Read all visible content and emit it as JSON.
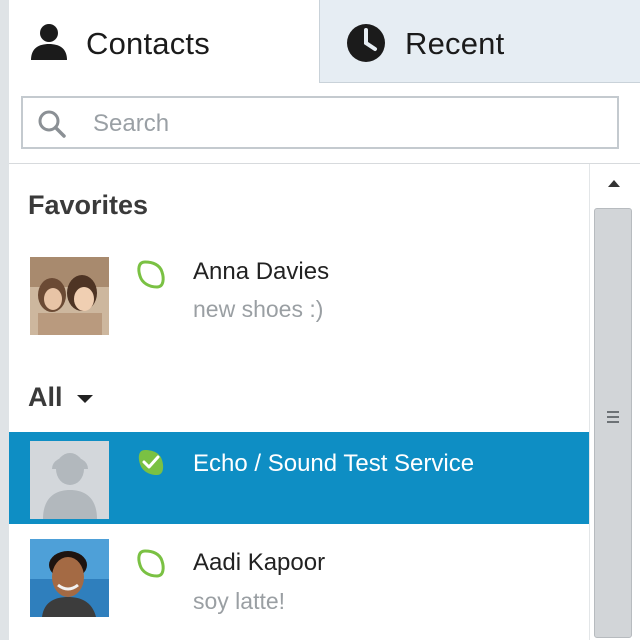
{
  "tabs": {
    "contacts_label": "Contacts",
    "recent_label": "Recent",
    "contacts_icon": "person-icon",
    "recent_icon": "clock-icon"
  },
  "search": {
    "placeholder": "Search",
    "value": "",
    "icon": "search-icon"
  },
  "favorites": {
    "heading": "Favorites",
    "contacts": [
      {
        "name": "Anna Davies",
        "mood": "new shoes :)",
        "status": "online",
        "avatar": "photo"
      }
    ]
  },
  "all": {
    "heading": "All",
    "contacts": [
      {
        "name": "Echo / Sound Test Service",
        "mood": "",
        "status": "online",
        "avatar": "default-silhouette",
        "selected": true
      },
      {
        "name": "Aadi Kapoor",
        "mood": "soy latte!",
        "status": "online",
        "avatar": "photo"
      }
    ]
  },
  "colors": {
    "selected_row": "#0e8ec4",
    "status_online": "#7ac143",
    "recent_tab_bg": "#e6edf3"
  }
}
